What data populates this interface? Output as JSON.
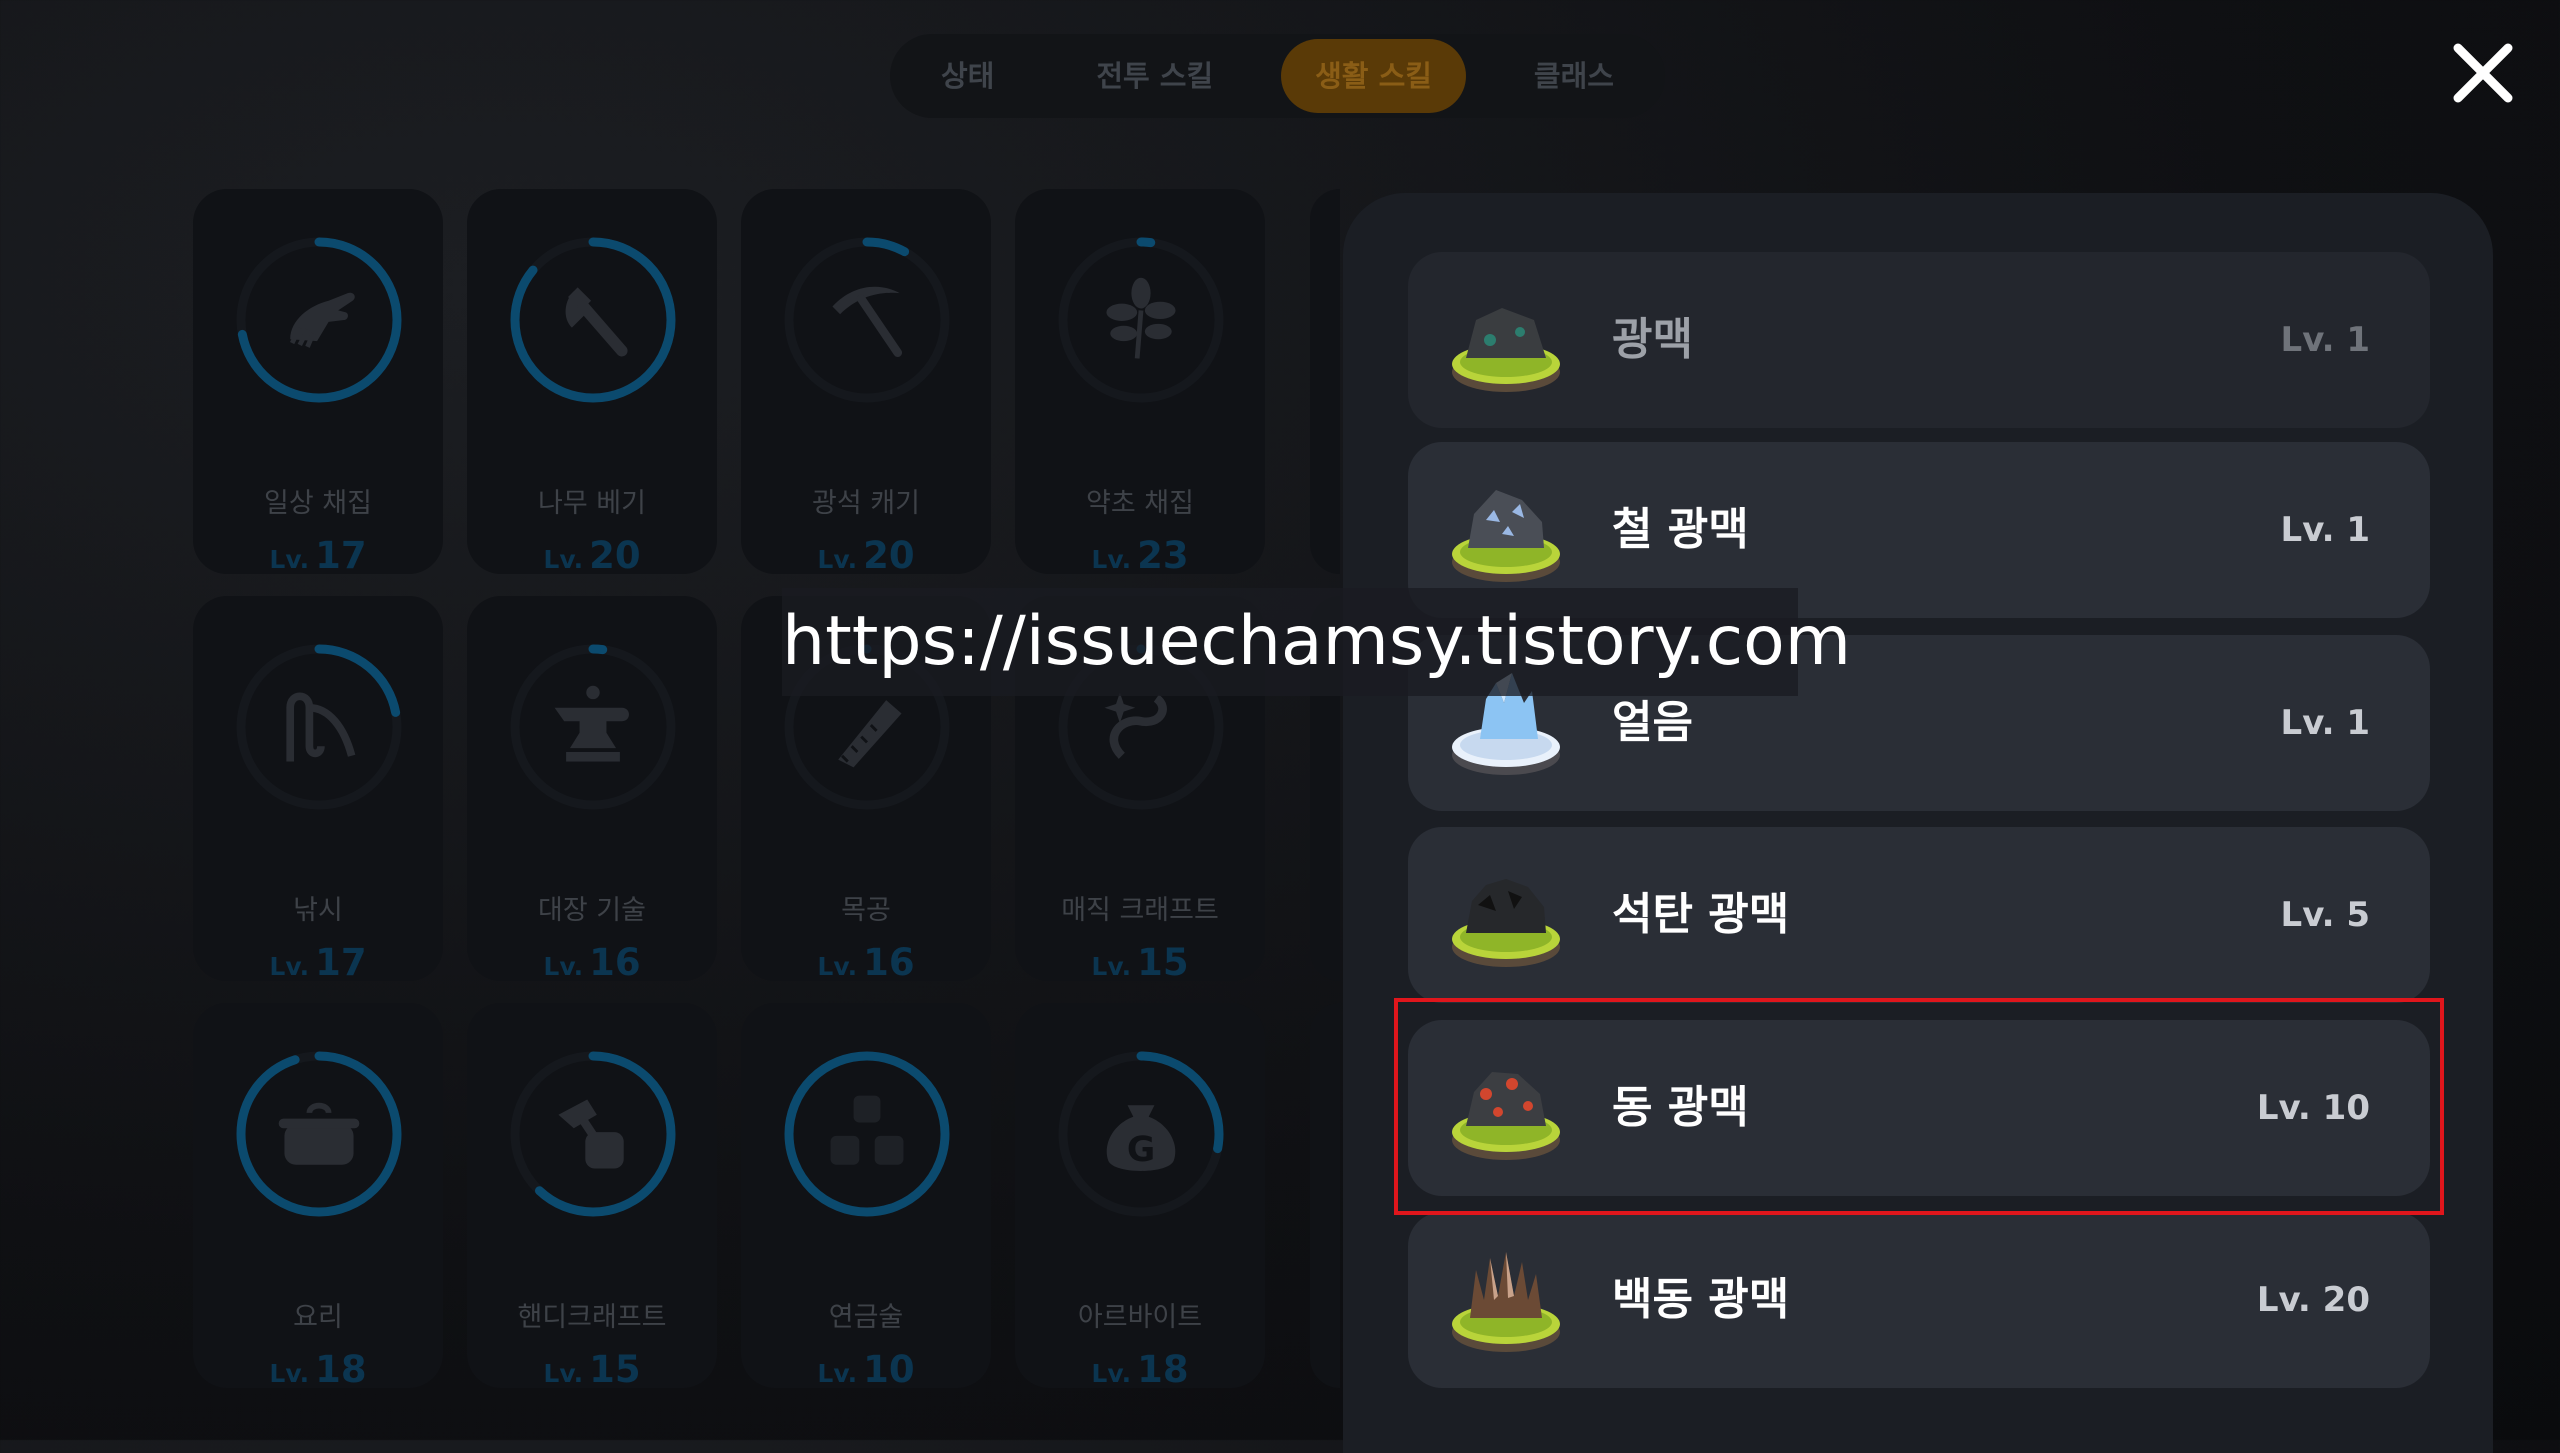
{
  "tabs": [
    {
      "label": "상태"
    },
    {
      "label": "전투 스킬"
    },
    {
      "label": "생활 스킬",
      "active": true
    },
    {
      "label": "클래스"
    }
  ],
  "skills": [
    {
      "name": "일상 채집",
      "lv": "17",
      "icon": "hand-gather-icon",
      "progress": 0.72
    },
    {
      "name": "나무 베기",
      "lv": "20",
      "icon": "axe-icon",
      "progress": 0.86
    },
    {
      "name": "광석 캐기",
      "lv": "20",
      "icon": "pickaxe-icon",
      "progress": 0.08
    },
    {
      "name": "약초 채집",
      "lv": "23",
      "icon": "herb-icon",
      "progress": 0.02
    },
    {
      "name": "낚시",
      "lv": "17",
      "icon": "fishing-rod-icon",
      "progress": 0.22
    },
    {
      "name": "대장 기술",
      "lv": "16",
      "icon": "anvil-icon",
      "progress": 0.02
    },
    {
      "name": "목공",
      "lv": "16",
      "icon": "saw-icon",
      "progress": 0.0
    },
    {
      "name": "매직 크래프트",
      "lv": "15",
      "icon": "magic-craft-icon",
      "progress": 0.0
    },
    {
      "name": "요리",
      "lv": "18",
      "icon": "cooking-pot-icon",
      "progress": 0.95
    },
    {
      "name": "핸디크래프트",
      "lv": "15",
      "icon": "hammer-fist-icon",
      "progress": 0.62
    },
    {
      "name": "연금술",
      "lv": "10",
      "icon": "alchemy-blocks-icon",
      "progress": 1.0
    },
    {
      "name": "아르바이트",
      "lv": "18",
      "icon": "money-bag-icon",
      "progress": 0.28
    }
  ],
  "lv_prefix": "Lv.",
  "veins": [
    {
      "name": "광맥",
      "lv": "Lv. 1",
      "icon": "stone-vein-icon",
      "dim": true
    },
    {
      "name": "철 광맥",
      "lv": "Lv. 1",
      "icon": "iron-vein-icon"
    },
    {
      "name": "얼음",
      "lv": "Lv. 1",
      "icon": "ice-crystal-icon"
    },
    {
      "name": "석탄 광맥",
      "lv": "Lv. 5",
      "icon": "coal-vein-icon"
    },
    {
      "name": "동 광맥",
      "lv": "Lv. 10",
      "icon": "copper-vein-icon",
      "highlighted": true
    },
    {
      "name": "백동 광맥",
      "lv": "Lv. 20",
      "icon": "cupronickel-vein-icon"
    }
  ],
  "watermark": "https://issuechamsy.tistory.com",
  "colors": {
    "ring_progress": "#0b4a6e",
    "ring_track": "#15181d",
    "active_tab": "#5a3a07",
    "highlight": "#e0161c"
  }
}
